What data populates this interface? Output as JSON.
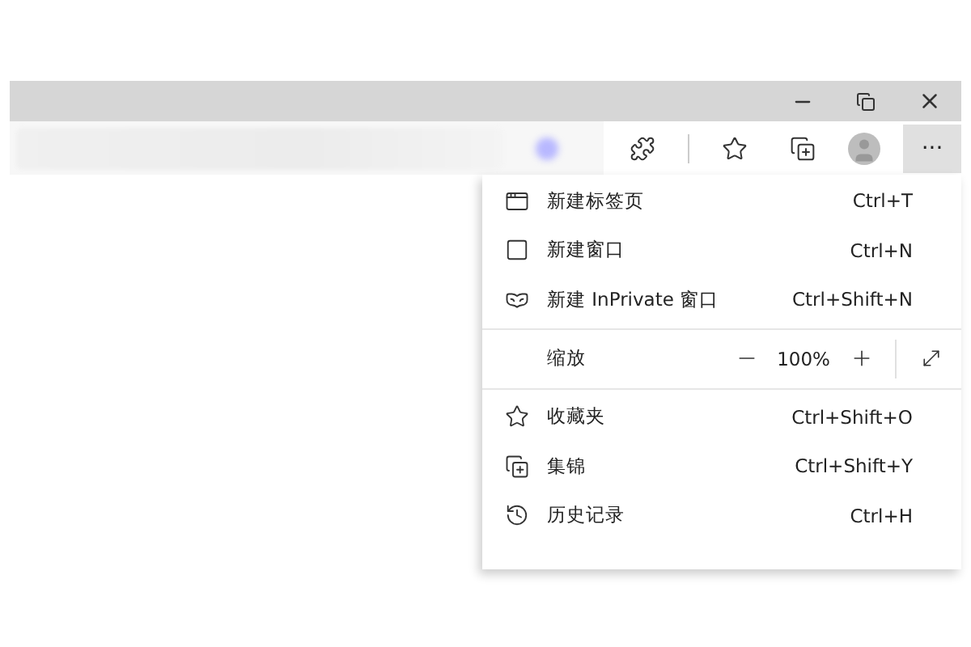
{
  "toolbar": {
    "more_button": "···"
  },
  "menu": {
    "items": [
      {
        "kind": "item",
        "label": "新建标签页",
        "shortcut": "Ctrl+T"
      },
      {
        "kind": "item",
        "label": "新建窗口",
        "shortcut": "Ctrl+N"
      },
      {
        "kind": "item",
        "label": "新建 InPrivate 窗口",
        "shortcut": "Ctrl+Shift+N"
      },
      {
        "kind": "zoom",
        "label": "缩放",
        "value": "100%"
      },
      {
        "kind": "item",
        "label": "收藏夹",
        "shortcut": "Ctrl+Shift+O"
      },
      {
        "kind": "item",
        "label": "集锦",
        "shortcut": "Ctrl+Shift+Y"
      },
      {
        "kind": "item",
        "label": "历史记录",
        "shortcut": "Ctrl+H"
      }
    ]
  }
}
